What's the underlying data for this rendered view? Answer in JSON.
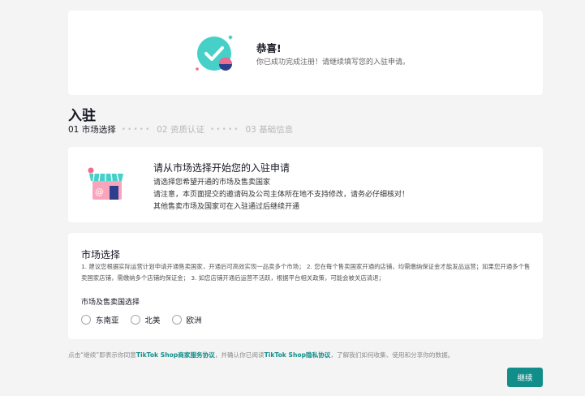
{
  "congrats": {
    "title": "恭喜!",
    "desc": "你已成功完成注册！请继续填写您的入驻申请。"
  },
  "heading": "入驻",
  "steps": [
    {
      "label": "01 市场选择",
      "active": true
    },
    {
      "label": "02 资质认证",
      "active": false
    },
    {
      "label": "03 基础信息",
      "active": false
    }
  ],
  "intro": {
    "title": "请从市场选择开始您的入驻申请",
    "lines": [
      "请选择您希望开通的市场及售卖国家",
      "请注意，本页面提交的邀请码及公司主体所在地不支持修改，请务必仔细核对！",
      "其他售卖市场及国家可在入驻通过后继续开通"
    ]
  },
  "market": {
    "title": "市场选择",
    "note": "1. 建议您根据实际运营计划申请开通售卖国家，开通后可高效实现一品卖多个市场； 2. 您在每个售卖国家开通的店铺，均需缴纳保证金才能发品运营；如果您开通多个售卖国家店铺，需缴纳多个店铺的保证金； 3. 如您店铺开通后运营不活跃，根据平台相关政策，可能会被关店清退；",
    "label": "市场及售卖国选择",
    "options": [
      "东南亚",
      "北美",
      "欧洲"
    ]
  },
  "agreement": {
    "prefix": "点击“继续”即表示你同意",
    "link1": "TikTok Shop商家服务协议",
    "middle": "，并确认你已阅读",
    "link2": "TikTok Shop隐私协议",
    "suffix": "，了解我们如何收集、使用和分享你的数据。"
  },
  "continue_label": "继续",
  "colors": {
    "accent": "#128e8a",
    "teal_icon": "#46d0c8",
    "pink": "#f26a8d",
    "navy": "#2c3f8c"
  }
}
